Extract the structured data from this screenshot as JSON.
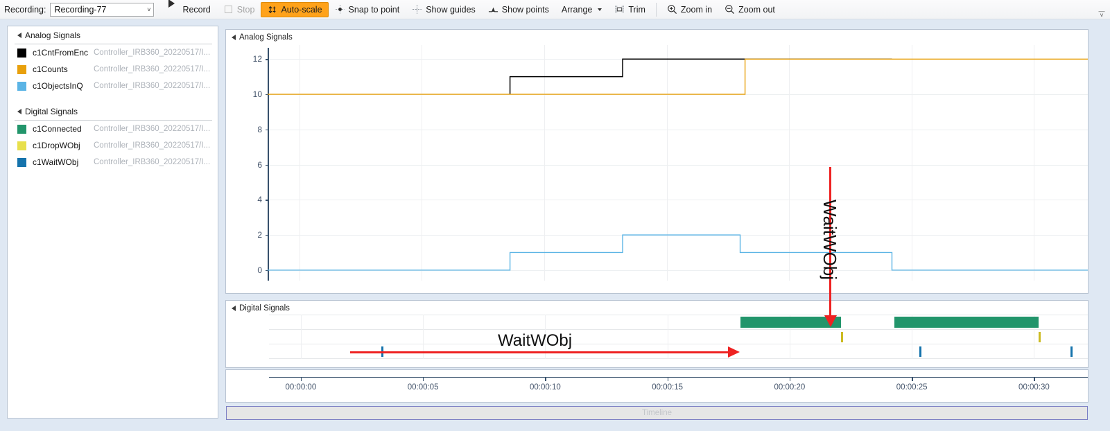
{
  "toolbar": {
    "recording_label": "Recording:",
    "recording_value": "Recording-77",
    "record": "Record",
    "stop": "Stop",
    "autoscale": "Auto-scale",
    "snap_to_point": "Snap to point",
    "show_guides": "Show guides",
    "show_points": "Show points",
    "arrange": "Arrange",
    "trim": "Trim",
    "zoom_in": "Zoom in",
    "zoom_out": "Zoom out"
  },
  "sidebar": {
    "analog_group": "Analog Signals",
    "digital_group": "Digital Signals",
    "analog_signals": [
      {
        "name": "c1CntFromEnc",
        "path": "Controller_IRB360_20220517/I...",
        "color": "#000000"
      },
      {
        "name": "c1Counts",
        "path": "Controller_IRB360_20220517/I...",
        "color": "#e8a00c"
      },
      {
        "name": "c1ObjectsInQ",
        "path": "Controller_IRB360_20220517/I...",
        "color": "#5bb4e5"
      }
    ],
    "digital_signals": [
      {
        "name": "c1Connected",
        "path": "Controller_IRB360_20220517/I...",
        "color": "#22956b"
      },
      {
        "name": "c1DropWObj",
        "path": "Controller_IRB360_20220517/I...",
        "color": "#e8e04c"
      },
      {
        "name": "c1WaitWObj",
        "path": "Controller_IRB360_20220517/I...",
        "color": "#1573ac"
      }
    ]
  },
  "analog_panel": {
    "title": "Analog Signals"
  },
  "digital_panel": {
    "title": "Digital Signals"
  },
  "timeline": {
    "label": "Timeline"
  },
  "annotations": {
    "vertical_label": "WaitWObj",
    "horizontal_label": "WaitWObj"
  },
  "chart_data": [
    {
      "type": "line",
      "title": "Analog Signals",
      "xlabel": "",
      "ylabel": "",
      "ylim": [
        -0.6,
        12.8
      ],
      "yticks": [
        0,
        2,
        4,
        6,
        8,
        10,
        12
      ],
      "xlim": [
        -1.3,
        32.2
      ],
      "grid": true,
      "step": true,
      "series": [
        {
          "name": "c1CntFromEnc",
          "color": "#000000",
          "points": [
            [
              8.6,
              10
            ],
            [
              8.6,
              11
            ],
            [
              13.2,
              11
            ],
            [
              13.2,
              12
            ],
            [
              24.2,
              12
            ]
          ]
        },
        {
          "name": "c1Counts",
          "color": "#e8a00c",
          "points": [
            [
              -1.3,
              10
            ],
            [
              18.2,
              10
            ],
            [
              18.2,
              12
            ],
            [
              32.2,
              12
            ]
          ]
        },
        {
          "name": "c1ObjectsInQ",
          "color": "#5bb4e5",
          "points": [
            [
              -1.3,
              0
            ],
            [
              8.6,
              0
            ],
            [
              8.6,
              1
            ],
            [
              13.2,
              1
            ],
            [
              13.2,
              2
            ],
            [
              18.0,
              2
            ],
            [
              18.0,
              1
            ],
            [
              24.2,
              1
            ],
            [
              24.2,
              0
            ],
            [
              32.2,
              0
            ]
          ]
        }
      ]
    },
    {
      "type": "timeline",
      "title": "Digital Signals",
      "xlim": [
        -1.3,
        32.2
      ],
      "rows": [
        {
          "name": "c1Connected",
          "color": "#22956b",
          "kind": "bar",
          "intervals": [
            [
              18.0,
              22.1
            ],
            [
              24.3,
              30.2
            ]
          ]
        },
        {
          "name": "c1DropWObj",
          "color": "#ccbb22",
          "kind": "tick",
          "times": [
            22.1,
            30.2
          ]
        },
        {
          "name": "c1WaitWObj",
          "color": "#1573ac",
          "kind": "tick",
          "times": [
            3.3,
            25.3,
            31.5
          ]
        }
      ]
    }
  ],
  "time_axis": {
    "ticks": [
      {
        "value": 0,
        "label": "00:00:00"
      },
      {
        "value": 5,
        "label": "00:00:05"
      },
      {
        "value": 10,
        "label": "00:00:10"
      },
      {
        "value": 15,
        "label": "00:00:15"
      },
      {
        "value": 20,
        "label": "00:00:20"
      },
      {
        "value": 25,
        "label": "00:00:25"
      },
      {
        "value": 30,
        "label": "00:00:30"
      }
    ]
  }
}
